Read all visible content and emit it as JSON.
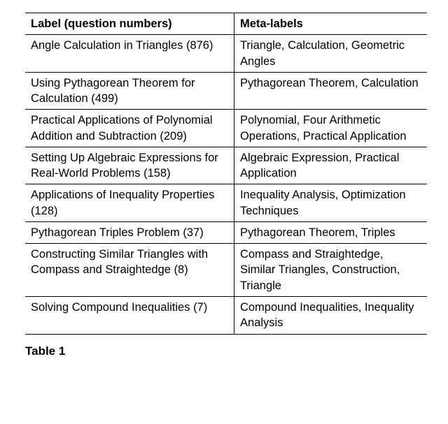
{
  "table": {
    "headers": {
      "label": "Label (question numbers)",
      "meta": "Meta-labels"
    },
    "rows": [
      {
        "label": "Angle Calculation in Triangles (876)",
        "meta": "Triangle, Calculation, Geometric Angles"
      },
      {
        "label": "Using Pythagorean Theorem for Calculation (499)",
        "meta": "Pythagorean Theorem, Calculation"
      },
      {
        "label": "Practical Applications of Polynomial Addition and Subtraction (209)",
        "meta": "Polynomial, Four Arithmetic Operations, Practical Application"
      },
      {
        "label": "Setting Up Algebraic Expressions for Real-World Problems (158)",
        "meta": "Algebraic Expression, Practical Application"
      },
      {
        "label": "Applications of Inequality Properties (128)",
        "meta": "Inequality Analysis, Optimization Techniques"
      },
      {
        "label": "Pythagorean Triples Problem (37)",
        "meta": "Pythagorean Theorem, Triples"
      },
      {
        "label": "Constructing Similar Triangles with Compass and Straightedge (8)",
        "meta": "Compass and Straightedge, Similar Triangles, Construction, Triangle"
      },
      {
        "label": "Solving Compound Inequalities (7)",
        "meta": "Compound Inequalities, Inequality Analysis"
      }
    ]
  },
  "caption": "Table 1"
}
